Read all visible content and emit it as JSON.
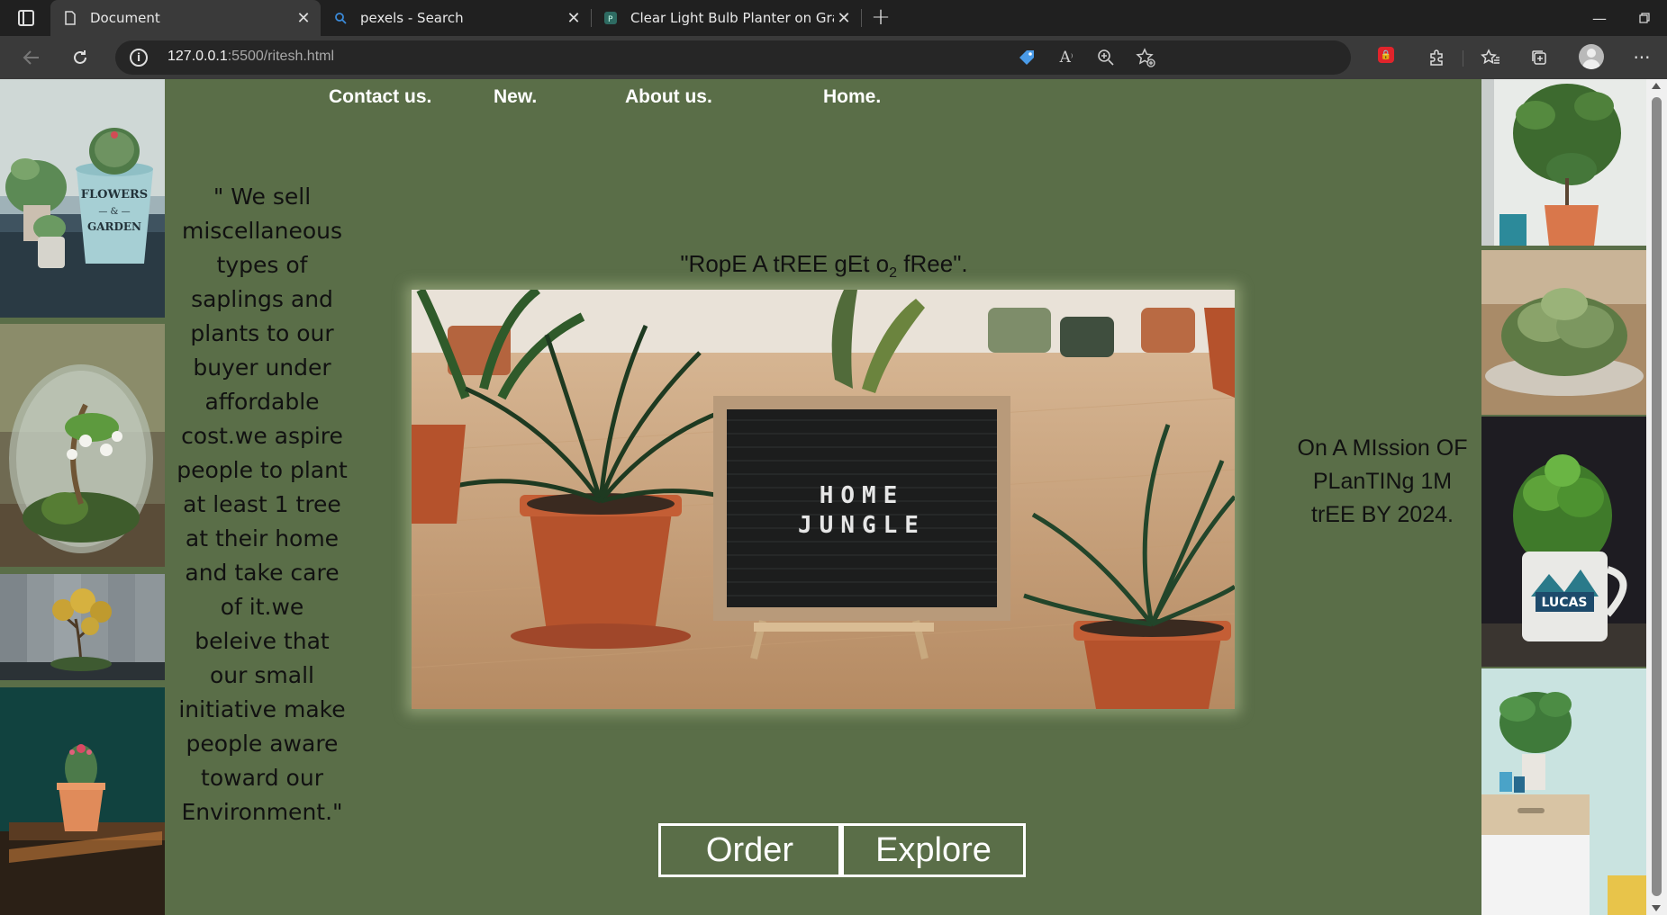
{
  "browser": {
    "tabs": [
      {
        "title": "Document",
        "icon": "document-icon",
        "active": true
      },
      {
        "title": "pexels - Search",
        "icon": "search-icon",
        "active": false
      },
      {
        "title": "Clear Light Bulb Planter on Gray",
        "icon": "pexels-icon",
        "active": false
      }
    ],
    "url_host": "127.0.0.1",
    "url_path": ":5500/ritesh.html"
  },
  "nav": {
    "contact": "Contact us.",
    "new": "New.",
    "about": "About us.",
    "home": "Home."
  },
  "left_text": "\" We sell miscellaneous types of saplings and plants to our buyer under affordable cost.we aspire people to plant at least 1 tree at their home and take care of it.we beleive that our small initiative make people aware toward our Environment.\"",
  "quote": {
    "before": "\"RopE A tREE gEt o",
    "sub": "2",
    "after": " fRee\"."
  },
  "hero": {
    "board_line1": "HOME",
    "board_line2": "JUNGLE"
  },
  "right_text": "On A MIssion OF PLanTINg 1M trEE BY 2024.",
  "buttons": {
    "order": "Order",
    "explore": "Explore"
  },
  "left_photos": [
    "flowers-garden-cactus-photo",
    "terrarium-photo",
    "bonsai-photo",
    "cactus-pot-photo"
  ],
  "right_photos": [
    "fiddle-leaf-plant-photo",
    "moss-bonsai-photo",
    "basil-mug-photo",
    "monstera-shelf-photo"
  ],
  "colors": {
    "page_bg": "#5a6e48",
    "text": "#111111",
    "nav_text": "#ffffff"
  }
}
